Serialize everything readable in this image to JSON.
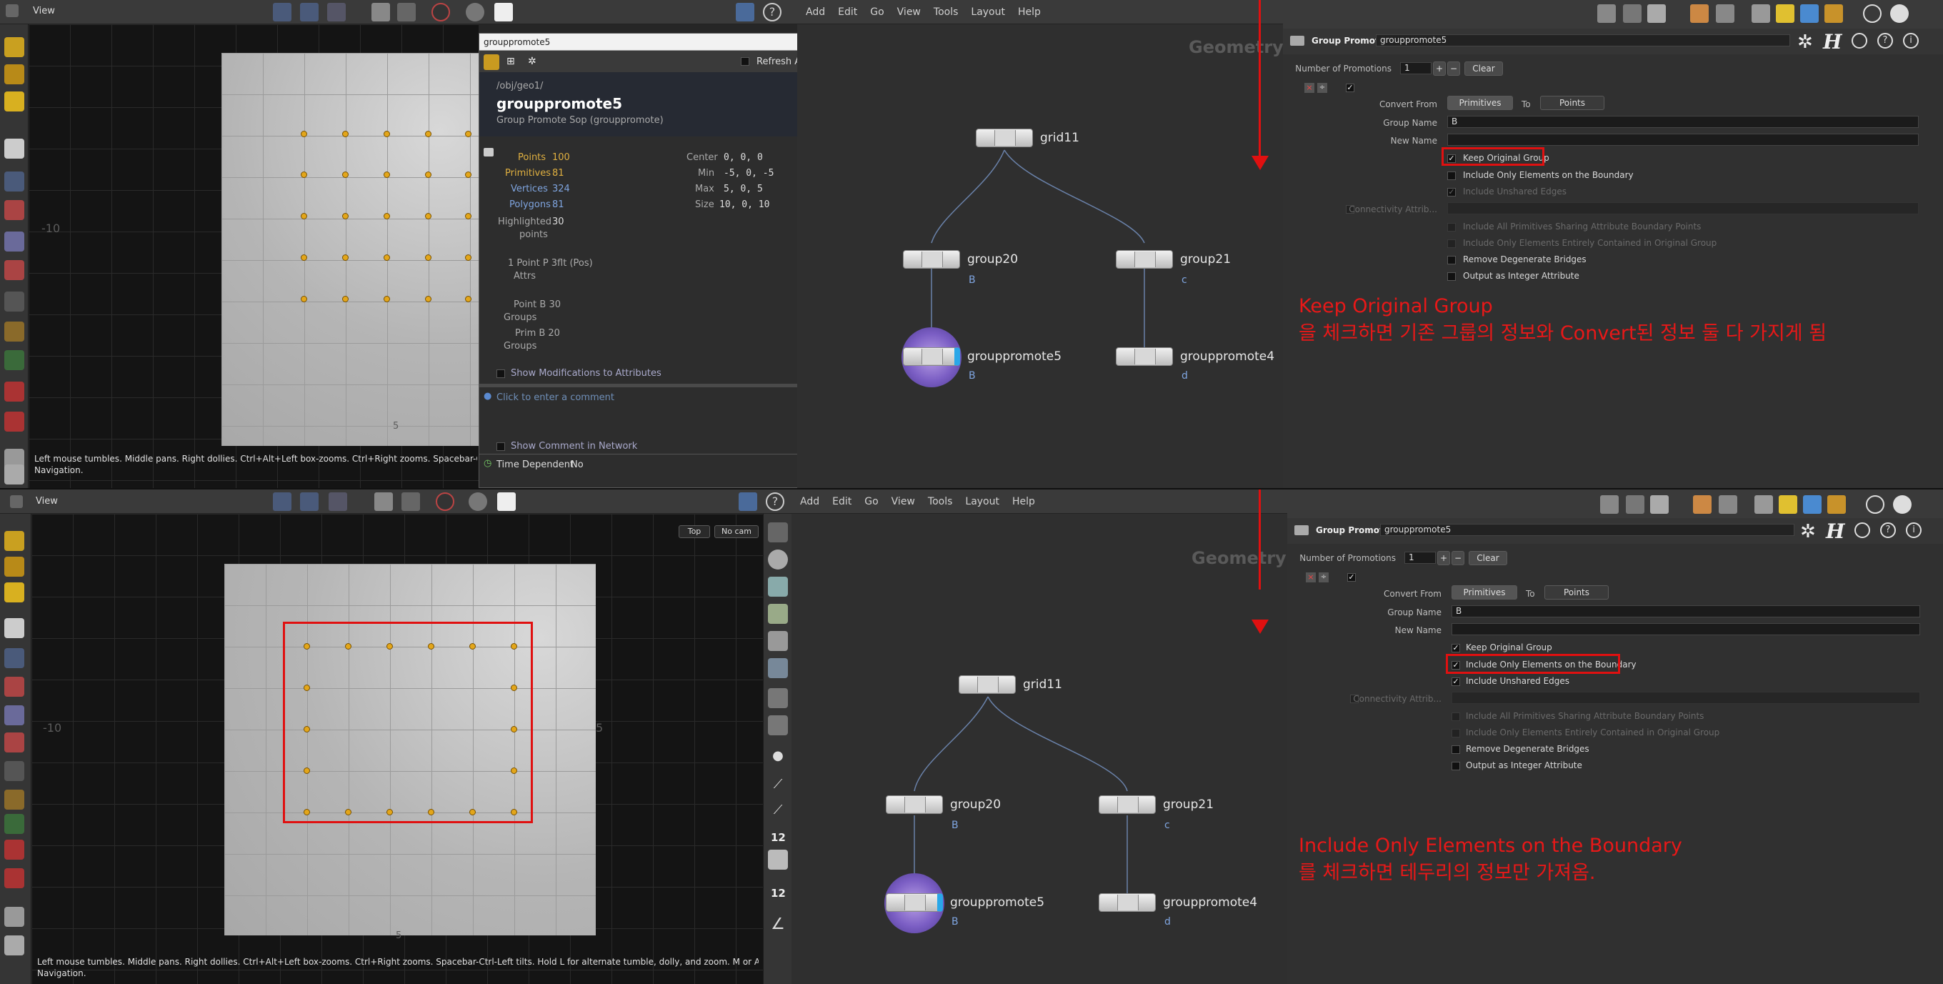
{
  "viewport": {
    "menu_label": "View",
    "axis_label_left": "-10",
    "axis_label_bottom": "5",
    "axis_label_right": "5",
    "hint_top": "Left mouse tumbles. Middle pans. Right dollies. Ctrl+Alt+Left box-zooms. Ctrl+Right zooms. Spacebar-Ctrl-Left tilts. Hold L for alternate tumble, dolly, and zoom.",
    "hint_top_line2": "Navigation.",
    "hint_bottom": "Left mouse tumbles. Middle pans. Right dollies. Ctrl+Alt+Left box-zooms. Ctrl+Right zooms. Spacebar-Ctrl-Left tilts. Hold L for alternate tumble, dolly, and zoom.    M or Alt+M for First Person",
    "hint_bottom_line2": "Navigation.",
    "view_top_btn": "Top",
    "view_cam_btn": "No cam",
    "side_num1": "12",
    "side_num2": "12"
  },
  "info_window": {
    "title": "grouppromote5",
    "refresh_label": "Refresh Automatically",
    "path": "/obj/geo1/",
    "node_name": "grouppromote5",
    "node_type": "Group Promote Sop (grouppromote)",
    "points_label": "Points",
    "points_value": "100",
    "prims_label": "Primitives",
    "prims_value": "81",
    "verts_label": "Vertices",
    "verts_value": "324",
    "polys_label": "Polygons",
    "polys_value": "81",
    "highlighted_label": "Highlighted",
    "highlighted_value": "30",
    "highlighted_unit": "points",
    "center_label": "Center",
    "center_value": "0, 0, 0",
    "min_label": "Min",
    "min_value": "-5, 0, -5",
    "max_label": "Max",
    "max_value": "5, 0, 5",
    "size_label": "Size",
    "size_value": "10, 0, 10",
    "attrs_line": "1 Point P 3flt (Pos)",
    "attrs_label": "Attrs",
    "point_groups": "Point B 30",
    "prim_groups": "Prim B 20",
    "groups_label": "Groups",
    "show_mods": "Show Modifications to Attributes",
    "comment_placeholder": "Click to enter a comment",
    "show_comment": "Show Comment in Network",
    "time_dep_label": "Time Dependent",
    "time_dep_value": "No"
  },
  "network": {
    "menu": [
      "Add",
      "Edit",
      "Go",
      "View",
      "Tools",
      "Layout",
      "Help"
    ],
    "context_label": "Geometry",
    "nodes": [
      {
        "name": "grid11",
        "sub": ""
      },
      {
        "name": "group20",
        "sub": "B"
      },
      {
        "name": "group21",
        "sub": "c"
      },
      {
        "name": "grouppromote5",
        "sub": "B"
      },
      {
        "name": "grouppromote4",
        "sub": "d"
      }
    ]
  },
  "params": {
    "node_type_label": "Group Promote",
    "node_name": "grouppromote5",
    "num_promotions_label": "Number of Promotions",
    "num_promotions_value": "1",
    "clear_label": "Clear",
    "convert_from_label": "Convert From",
    "convert_from_value": "Primitives",
    "to_label": "To",
    "to_value": "Points",
    "group_name_label": "Group Name",
    "group_name_value": "B",
    "new_name_label": "New Name",
    "keep_original": "Keep Original Group",
    "only_boundary": "Include Only Elements on the Boundary",
    "unshared_edges": "Include Unshared Edges",
    "connectivity": "Connectivity Attrib...",
    "all_prims_sharing": "Include All Primitives Sharing Attribute Boundary Points",
    "entirely_contained": "Include Only Elements Entirely Contained in Original Group",
    "remove_degenerate": "Remove Degenerate Bridges",
    "output_integer": "Output as Integer Attribute"
  },
  "annotations": {
    "top_line1": "Keep Original Group",
    "top_line2": "을 체크하면 기존 그룹의 정보와 Convert된 정보 둘 다 가지게 됨",
    "bottom_line1": "Include Only Elements on the Boundary",
    "bottom_line2": "를 체크하면 테두리의 정보만 가져옴.",
    "color": "#e81818"
  }
}
